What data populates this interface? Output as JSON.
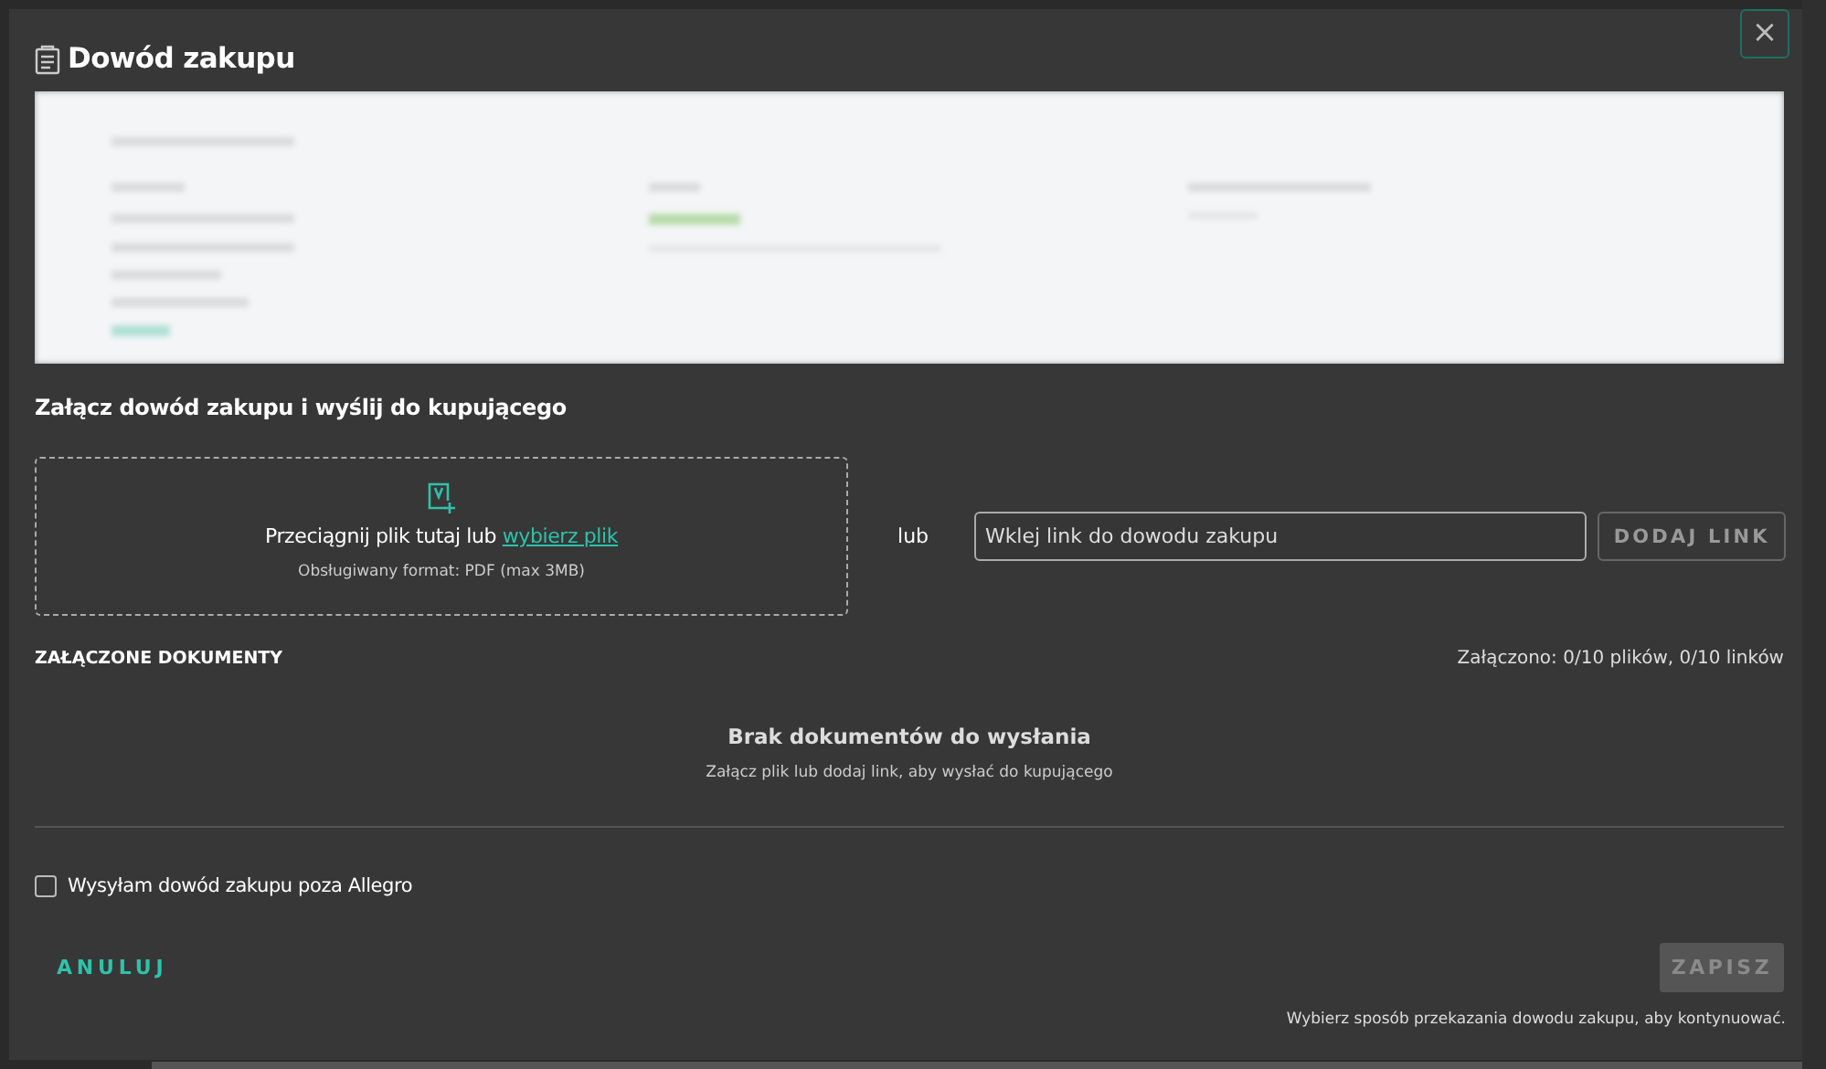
{
  "dialog": {
    "title": "Dowód zakupu",
    "close": "×"
  },
  "attach": {
    "heading": "Załącz dowód zakupu i wyślij do kupującego",
    "dropzone": {
      "text": "Przeciągnij plik tutaj lub ",
      "link": "wybierz plik",
      "hint": "Obsługiwany format: PDF (max 3MB)"
    },
    "separator": "lub",
    "link_field": {
      "placeholder": "Wklej link do dowodu zakupu"
    },
    "add_button": {
      "label": "DODAJ LINK",
      "disabled": true
    }
  },
  "documents": {
    "heading": "ZAŁĄCZONE DOKUMENTY",
    "counter": "Załączono: 0/10 plików, 0/10 linków",
    "empty_title": "Brak dokumentów do wysłania",
    "empty_hint": "Załącz plik lub dodaj link, aby wysłać do kupującego"
  },
  "outside_checkbox": {
    "label": "Wysyłam dowód zakupu poza Allegro",
    "checked": false
  },
  "footer": {
    "cancel": "ANULUJ",
    "save": {
      "label": "ZAPISZ",
      "disabled": true
    },
    "note": "Wybierz sposób przekazania dowodu zakupu, aby kontynuować."
  }
}
